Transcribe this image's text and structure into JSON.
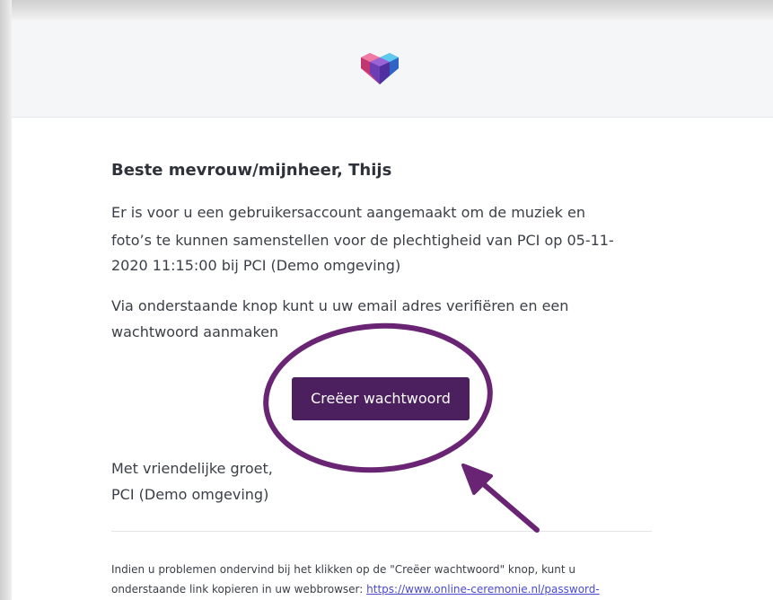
{
  "header": {
    "logo_icon": "heart-cube-logo-icon"
  },
  "email": {
    "greeting": "Beste mevrouw/mijnheer, Thijs",
    "paragraph1": [
      "Er is voor u een gebruikersaccount aangemaakt om de muziek en",
      "foto’s te kunnen samenstellen voor de plechtigheid van PCI op 05-11-",
      "2020 11:15:00 bij PCI (Demo omgeving)"
    ],
    "paragraph2": [
      "Via onderstaande knop kunt u uw email adres verifiëren en een",
      "wachtwoord aanmaken"
    ],
    "button_label": "Creëer wachtwoord",
    "signoff": [
      "Met vriendelijke groet,",
      "PCI (Demo omgeving)"
    ],
    "footer": {
      "line1": "Indien u problemen ondervind bij het klikken op de \"Creëer wachtwoord\" knop, kunt u",
      "line2_prefix": "onderstaande link kopieren in uw webbrowser: ",
      "link_text": "https://www.online-ceremonie.nl/password-"
    }
  },
  "colors": {
    "button": "#4c1f5e",
    "annotation": "#6a2474",
    "header_bg": "#f5f6f8",
    "link": "#4a4ad0"
  },
  "annotation": {
    "circle_icon": "highlight-ellipse",
    "arrow_icon": "pointer-arrow-icon"
  }
}
